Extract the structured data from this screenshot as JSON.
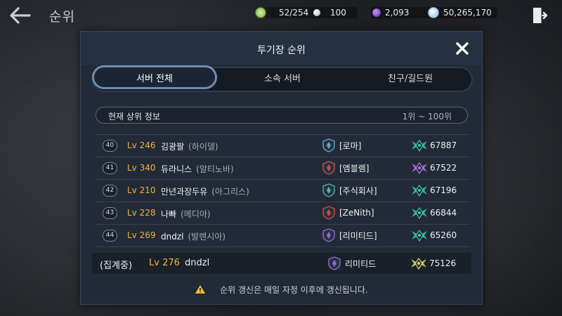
{
  "header": {
    "back_icon": "arrow-left-icon",
    "title": "순위",
    "exit_icon": "exit-door-icon",
    "resources": [
      {
        "icon": "stamina-icon",
        "color": "#9ed36b",
        "value": "52/254"
      },
      {
        "icon": "pearl-icon",
        "color": "#e0d7cf",
        "value": "100"
      },
      {
        "icon": "dark-gem-icon",
        "color": "#8a4be0",
        "value": "2,093"
      },
      {
        "icon": "silver-coin-icon",
        "color": "#b8d2ec",
        "value": "50,265,170"
      }
    ]
  },
  "panel": {
    "title": "투기장 순위",
    "close_icon": "close-icon",
    "tabs": [
      {
        "label": "서버 전체",
        "active": true
      },
      {
        "label": "소속 서버",
        "active": false
      },
      {
        "label": "친구/길드원",
        "active": false
      }
    ],
    "info_label": "현재 상위 정보",
    "info_range": "1위 ~ 100위"
  },
  "rows": [
    {
      "rank": "40",
      "level": "Lv 246",
      "name": "김광팔",
      "server": "(하이델)",
      "guild": "[로마]",
      "score": "67887",
      "crest_color": "#5fa5c8",
      "wing_color": "#3fc7a8"
    },
    {
      "rank": "41",
      "level": "Lv 340",
      "name": "듀라니스",
      "server": "(알티노바)",
      "guild": "[엠블렘]",
      "score": "67522",
      "crest_color": "#c8504a",
      "wing_color": "#b07ad8"
    },
    {
      "rank": "42",
      "level": "Lv 210",
      "name": "만년과장두유",
      "server": "(아그리스)",
      "guild": "[주식회사]",
      "score": "67196",
      "crest_color": "#4fb3a3",
      "wing_color": "#3fc7a8"
    },
    {
      "rank": "43",
      "level": "Lv 228",
      "name": "나빠",
      "server": "(메디아)",
      "guild": "[ZeNith]",
      "score": "66844",
      "crest_color": "#d0493c",
      "wing_color": "#3fc7a8"
    },
    {
      "rank": "44",
      "level": "Lv 269",
      "name": "dndzl",
      "server": "(발렌시아)",
      "guild": "[리미티드]",
      "score": "65260",
      "crest_color": "#8a6fd1",
      "wing_color": "#3fc7a8"
    }
  ],
  "my_rank": {
    "tag": "(집계중)",
    "level": "Lv 276",
    "name": "dndzl",
    "guild": "리미티드",
    "score": "75126",
    "crest_color": "#8a6fd1",
    "wing_color": "#d6d86a"
  },
  "notice": {
    "icon": "warning-icon",
    "text": "순위 갱신은 매일 자정 이후에 갱신됩니다."
  }
}
